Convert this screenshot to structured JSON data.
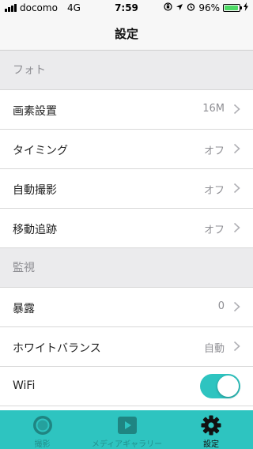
{
  "status_bar": {
    "carrier": "docomo",
    "network": "4G",
    "time": "7:59",
    "battery": "96%",
    "battery_fill": 0.96,
    "icons": [
      "orientation-lock-icon",
      "location-icon",
      "alarm-icon",
      "charging-icon"
    ]
  },
  "nav": {
    "title": "設定"
  },
  "sections": {
    "photo": {
      "header": "フォト",
      "rows": [
        {
          "label": "画素設置",
          "value": "16M"
        },
        {
          "label": "タイミング",
          "value": "オフ"
        },
        {
          "label": "自動撮影",
          "value": "オフ"
        },
        {
          "label": "移動追跡",
          "value": "オフ"
        }
      ]
    },
    "monitor": {
      "header": "監視",
      "rows": [
        {
          "label": "暴露",
          "value": "0"
        },
        {
          "label": "ホワイトバランス",
          "value": "自動"
        }
      ],
      "wifi": {
        "label": "WiFi",
        "enabled": true
      }
    }
  },
  "tabs": [
    {
      "label": "撮影",
      "icon": "camera-shutter-icon",
      "active": false
    },
    {
      "label": "メディアギャラリー",
      "icon": "play-icon",
      "active": false
    },
    {
      "label": "設定",
      "icon": "gear-icon",
      "active": true
    }
  ],
  "colors": {
    "accent": "#2ec4c0",
    "battery": "#4cd964",
    "section_bg": "#ebebed"
  }
}
